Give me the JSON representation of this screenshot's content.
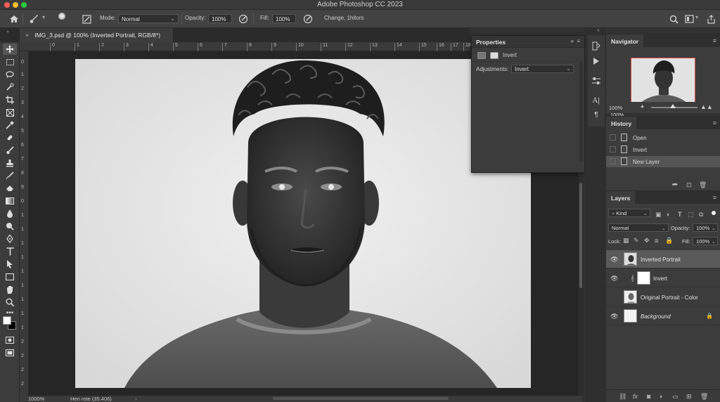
{
  "app": {
    "title": "Adobe Photoshop CC 2023"
  },
  "options_bar": {
    "home_icon": "home-icon",
    "mode_label": "Mode:",
    "mode_value": "Normal",
    "opacity_label": "Opacity:",
    "opacity_value": "100%",
    "fill_label": "Fill:",
    "fill_value": "100%",
    "status_text": "Change, 1hitors"
  },
  "tab": {
    "close_glyph": "×",
    "label": "IMG_3.psd @ 100% (Inverted Portrait, RGB/8*)"
  },
  "ruler": {
    "top_ticks": [
      "0",
      "1",
      "2",
      "3",
      "4",
      "5",
      "6",
      "7",
      "8",
      "9",
      "10",
      "11",
      "12",
      "13",
      "14",
      "15",
      "16",
      "17",
      "18"
    ],
    "left_ticks": [
      "0",
      "1",
      "2",
      "3",
      "4",
      "5",
      "6",
      "7",
      "8",
      "9",
      "0",
      "1",
      "1",
      "1",
      "1",
      "1",
      "1",
      "1",
      "1",
      "1",
      "2",
      "2",
      "2",
      "2"
    ]
  },
  "properties": {
    "title": "Properties",
    "header_name": "Invert",
    "adjustments_label": "Adjustments:",
    "adjustments_value": "Invert"
  },
  "navigator": {
    "title": "Navigator",
    "zoom": "100%",
    "zoom_slider_fraction": 0.47
  },
  "history": {
    "title": "History",
    "items": [
      {
        "label": "Open"
      },
      {
        "label": "Invert"
      },
      {
        "label": "New Layer"
      }
    ]
  },
  "layers": {
    "title": "Layers",
    "kind_label": "Kind",
    "blend_mode": "Normal",
    "opacity_label": "Opacity:",
    "opacity_value": "100%",
    "lock_label": "Lock:",
    "fill_label": "Fill:",
    "fill_value": "100%",
    "rows": [
      {
        "name": "Inverted Portrait"
      },
      {
        "name": "Invert"
      },
      {
        "name": "Original Portrait - Color"
      },
      {
        "name": "Background"
      }
    ]
  },
  "status_bar": {
    "zoom": "1000%",
    "info": "Hen rote (35.406)"
  },
  "colors": {
    "accent": "#d2504a",
    "panel_bg": "#3c3c3c",
    "canvas_bg": "#262626",
    "selected_row": "#5a5a5a"
  }
}
